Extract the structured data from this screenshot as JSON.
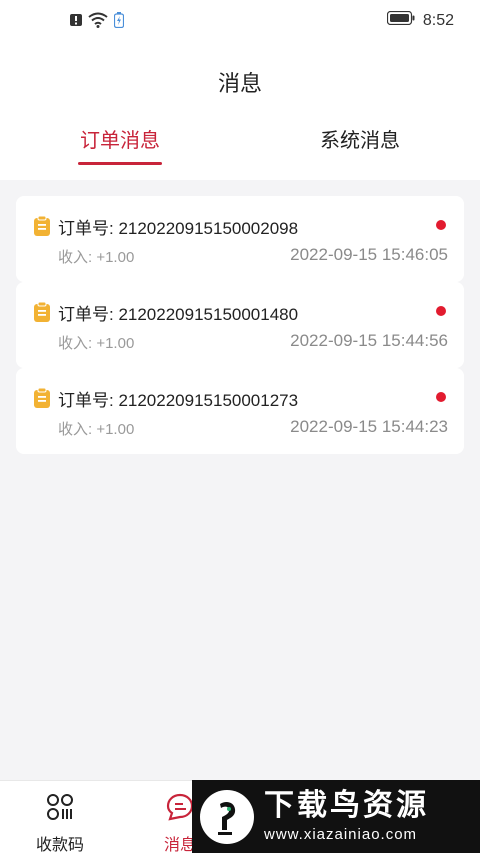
{
  "status_bar": {
    "time": "8:52",
    "icons": [
      "alert-icon",
      "wifi-icon",
      "battery-saver-icon",
      "battery-icon"
    ]
  },
  "page": {
    "title": "消息"
  },
  "tabs": [
    {
      "label": "订单消息",
      "active": true
    },
    {
      "label": "系统消息",
      "active": false
    }
  ],
  "messages": [
    {
      "order_label": "订单号: 2120220915150002098",
      "income": "收入: +1.00",
      "time": "2022-09-15 15:46:05",
      "unread": true
    },
    {
      "order_label": "订单号: 2120220915150001480",
      "income": "收入: +1.00",
      "time": "2022-09-15 15:44:56",
      "unread": true
    },
    {
      "order_label": "订单号: 2120220915150001273",
      "income": "收入: +1.00",
      "time": "2022-09-15 15:44:23",
      "unread": true
    }
  ],
  "bottom_nav": [
    {
      "label": "收款码",
      "icon": "qr-code-icon",
      "active": false
    },
    {
      "label": "消息",
      "icon": "chat-bubble-icon",
      "active": true
    }
  ],
  "watermark": {
    "main_text": "下载鸟资源",
    "url": "www.xiazainiao.com"
  },
  "colors": {
    "accent": "#c8243a",
    "unread_dot": "#e21b2f",
    "doc_icon": "#f2b233",
    "background": "#f4f4f6"
  }
}
